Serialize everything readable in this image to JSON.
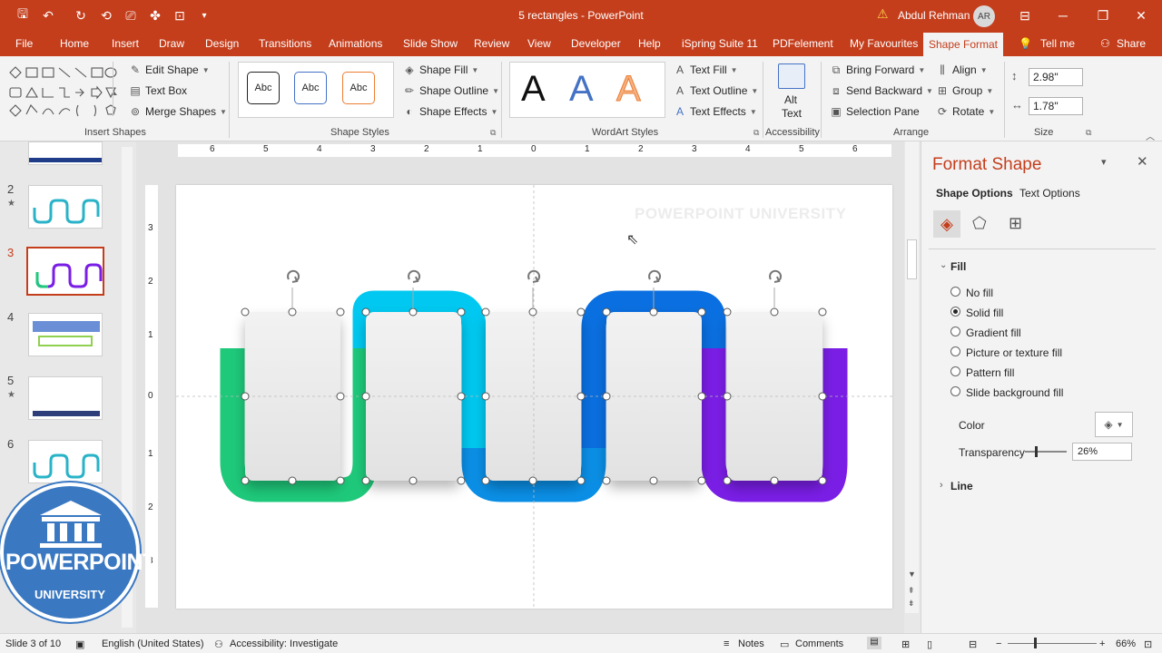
{
  "window": {
    "title": "5 rectangles  -  PowerPoint",
    "user": "Abdul Rehman",
    "avatar_initials": "AR"
  },
  "tabs": [
    "File",
    "Home",
    "Insert",
    "Draw",
    "Design",
    "Transitions",
    "Animations",
    "Slide Show",
    "Review",
    "View",
    "Developer",
    "Help",
    "iSpring Suite 11",
    "PDFelement",
    "My Favourites",
    "Shape Format",
    "Tell me",
    "Share"
  ],
  "ribbon": {
    "insert_shapes": {
      "edit_shape": "Edit Shape",
      "text_box": "Text Box",
      "merge_shapes": "Merge Shapes",
      "label": "Insert Shapes"
    },
    "shape_styles": {
      "sample": "Abc",
      "shape_fill": "Shape Fill",
      "shape_outline": "Shape Outline",
      "shape_effects": "Shape Effects",
      "label": "Shape Styles"
    },
    "wordart": {
      "letter": "A",
      "text_fill": "Text Fill",
      "text_outline": "Text Outline",
      "text_effects": "Text Effects",
      "label": "WordArt Styles"
    },
    "accessibility": {
      "alt_text_1": "Alt",
      "alt_text_2": "Text",
      "label": "Accessibility"
    },
    "arrange": {
      "bring_forward": "Bring Forward",
      "send_backward": "Send Backward",
      "selection_pane": "Selection Pane",
      "align": "Align",
      "group": "Group",
      "rotate": "Rotate",
      "label": "Arrange"
    },
    "size": {
      "height": "2.98\"",
      "width": "1.78\"",
      "label": "Size"
    }
  },
  "thumbnails": [
    {
      "num": "2",
      "star": "★"
    },
    {
      "num": "3",
      "star": ""
    },
    {
      "num": "4",
      "star": ""
    },
    {
      "num": "5",
      "star": "★"
    },
    {
      "num": "6",
      "star": ""
    }
  ],
  "ruler_h": [
    "6",
    "5",
    "4",
    "3",
    "2",
    "1",
    "0",
    "1",
    "2",
    "3",
    "4",
    "5",
    "6"
  ],
  "ruler_v": [
    "3",
    "2",
    "1",
    "0",
    "1",
    "2",
    "3"
  ],
  "slide": {
    "watermark": "POWERPOINT UNIVERSITY"
  },
  "colors": {
    "green": "#1ec97a",
    "cyan": "#00c8f0",
    "blue": "#0a6fe0",
    "purple": "#7a1ee6",
    "accent": "#c43e1c"
  },
  "pane": {
    "title": "Format Shape",
    "tab_shape": "Shape Options",
    "tab_text": "Text Options",
    "fill_header": "Fill",
    "options": [
      "No fill",
      "Solid fill",
      "Gradient fill",
      "Picture or texture fill",
      "Pattern fill",
      "Slide background fill"
    ],
    "selected_option": 1,
    "color_label": "Color",
    "transparency_label": "Transparency",
    "transparency_value": "26%",
    "transparency_fraction": 0.26,
    "line_header": "Line"
  },
  "logo": {
    "line1": "POWERPOINT",
    "line2": "UNIVERSITY"
  },
  "status": {
    "slide": "Slide 3 of 10",
    "language": "English (United States)",
    "accessibility": "Accessibility: Investigate",
    "notes": "Notes",
    "comments": "Comments",
    "zoom": "66%"
  }
}
